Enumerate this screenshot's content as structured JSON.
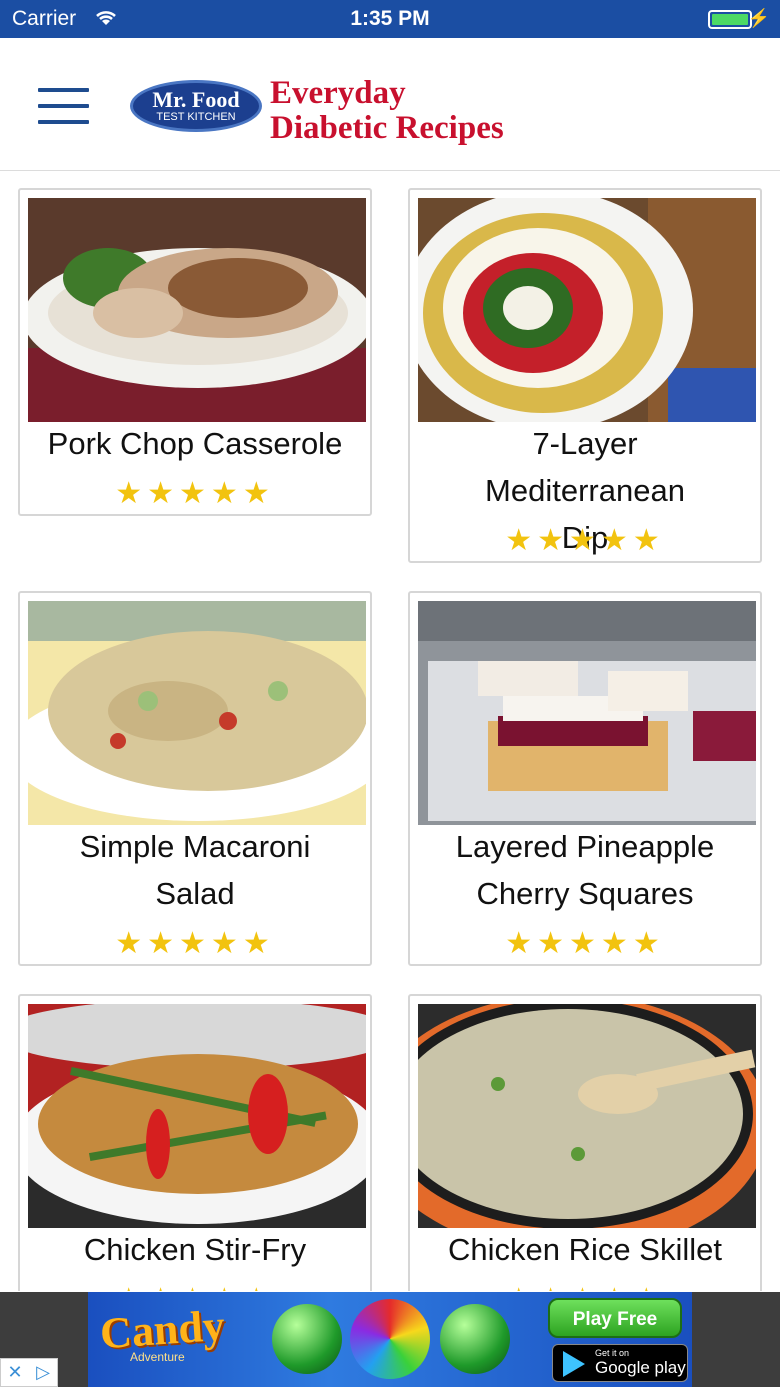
{
  "status_bar": {
    "carrier": "Carrier",
    "time": "1:35 PM",
    "battery_level": 1.0,
    "wifi_icon": "wifi-icon",
    "charging_icon": "bolt-icon"
  },
  "header": {
    "menu_icon": "hamburger-menu-icon",
    "logo_line1": "Mr. Food",
    "logo_line2": "TEST KITCHEN",
    "title_line1": "Everyday",
    "title_line2": "Diabetic Recipes",
    "title_color": "#c8102e",
    "logo_color": "#1c3f8f"
  },
  "recipes": [
    {
      "name": "Pork Chop Casserole",
      "rating": 5,
      "stars": "★★★★★"
    },
    {
      "name": "7-Layer Mediterranean Dip",
      "rating": 5,
      "stars": "★★★★★"
    },
    {
      "name": "Simple Macaroni Salad",
      "rating": 5,
      "stars": "★★★★★"
    },
    {
      "name": "Layered Pineapple Cherry Squares",
      "rating": 5,
      "stars": "★★★★★"
    },
    {
      "name": "Chicken Stir-Fry",
      "rating": 5,
      "stars": "★★★★★"
    },
    {
      "name": "Chicken Rice Skillet",
      "rating": 5,
      "stars": "★★★★★"
    }
  ],
  "ad": {
    "brand_main": "Candy",
    "brand_sub": "Adventure",
    "cta": "Play Free",
    "store_line1": "Get it on",
    "store_line2": "Google play",
    "close_glyph": "✕",
    "adchoices_glyph": "▷"
  },
  "colors": {
    "status_bar": "#1b4ea3",
    "star": "#f2c30f",
    "menu": "#1e4c8f"
  }
}
